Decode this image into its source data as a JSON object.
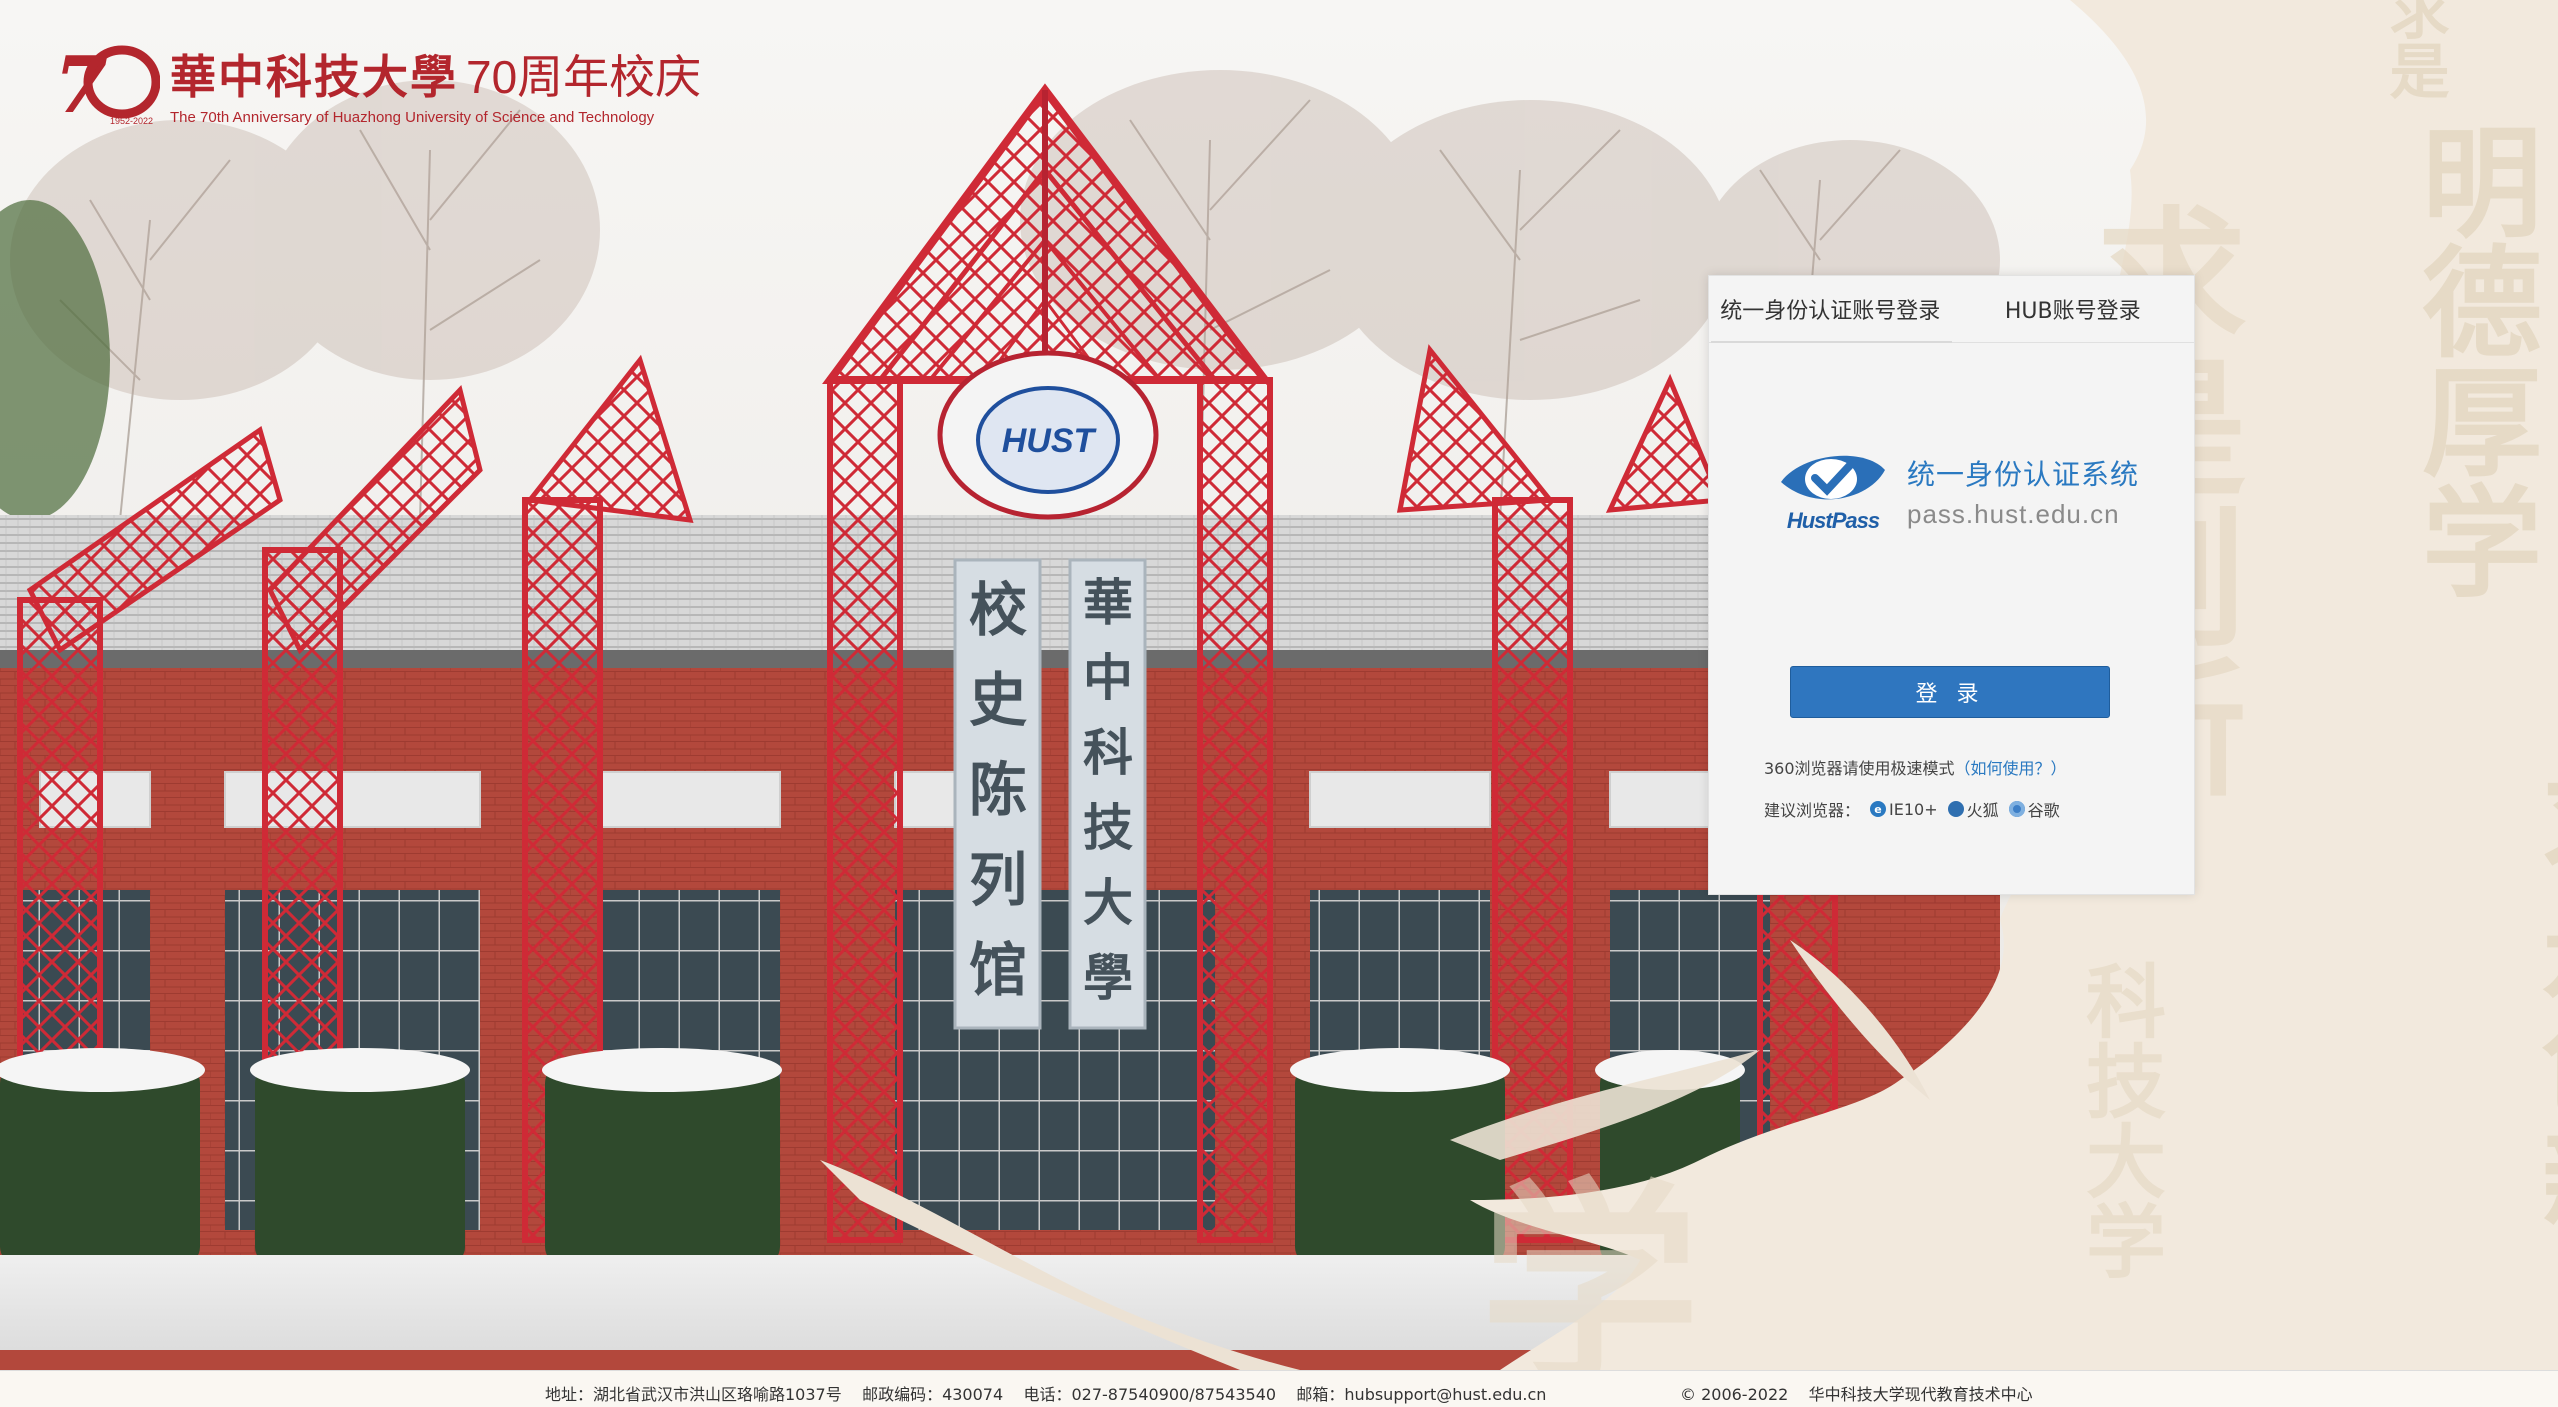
{
  "header": {
    "logo_number": "70",
    "logo_years": "1952-2022",
    "title_cn": "華中科技大學",
    "title_suffix": "70周年校庆",
    "subtitle_en": "The 70th Anniversary of Huazhong University of Science and Technology"
  },
  "scene": {
    "building_sign_left": [
      "校",
      "史",
      "陈",
      "列",
      "馆"
    ],
    "building_sign_right": [
      "華",
      "中",
      "科",
      "技",
      "大",
      "學"
    ],
    "emblem_text": "HUST",
    "calligraphy": {
      "top_right_small": "求是",
      "col_far_right": "明德厚学",
      "col_far_right_2": "求是创新",
      "col_mid": "求是创新",
      "col_small": "科技大学",
      "big_char": "学"
    }
  },
  "login": {
    "tabs": [
      {
        "label": "统一身份认证账号登录",
        "active": true
      },
      {
        "label": "HUB账号登录",
        "active": false
      }
    ],
    "system_name": "统一身份认证系统",
    "system_url": "pass.hust.edu.cn",
    "brand_mark": "HustPass",
    "login_button": "登 录",
    "tip_360": "360浏览器请使用极速模式",
    "tip_link": "（如何使用？）",
    "browsers_label": "建议浏览器：",
    "browsers": [
      {
        "name": "IE10+",
        "icon": "ie-icon",
        "color": "#2a79c1"
      },
      {
        "name": "火狐",
        "icon": "firefox-icon",
        "color": "#2f6fb0"
      },
      {
        "name": "谷歌",
        "icon": "chrome-icon",
        "color": "#3d7fc7"
      }
    ]
  },
  "footer": {
    "address": "地址：湖北省武汉市洪山区珞喻路1037号    邮政编码：430074    电话：027-87540900/87543540    邮箱：hubsupport@hust.edu.cn",
    "copyright": "© 2006-2022    华中科技大学现代教育技术中心"
  },
  "colors": {
    "brand_red": "#b3262d",
    "accent_blue": "#2f76bf",
    "panel_bg": "#f4f4f4"
  }
}
